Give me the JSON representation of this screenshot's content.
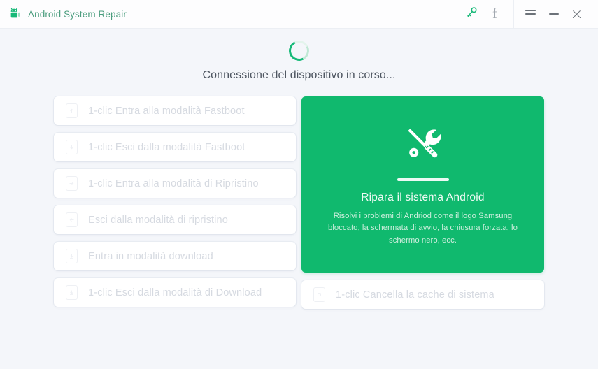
{
  "window": {
    "title": "Android System Repair",
    "logo_icon": "android-robot-icon",
    "controls": [
      {
        "name": "register-key-button",
        "icon": "key-icon",
        "label": "",
        "color": "#17b978"
      },
      {
        "name": "facebook-button",
        "icon": "facebook-f-icon",
        "label": "f",
        "color": "#a2a8b0"
      },
      {
        "name": "menu-button",
        "icon": "hamburger-menu-icon",
        "label": "",
        "color": "#6c7279"
      },
      {
        "name": "minimize-button",
        "icon": "minimize-icon",
        "label": "",
        "color": "#6c7279"
      },
      {
        "name": "close-button",
        "icon": "close-icon",
        "label": "",
        "color": "#6c7279"
      }
    ]
  },
  "status": {
    "spinner_icon": "loading-spinner-icon",
    "text": "Connessione del dispositivo in corso..."
  },
  "options": [
    {
      "icon": "phone-arrow-up-icon",
      "label": "1-clic Entra alla modalità Fastboot"
    },
    {
      "icon": "phone-arrow-down-icon",
      "label": "1-clic Esci dalla modalità Fastboot"
    },
    {
      "icon": "phone-arrow-right-icon",
      "label": "1-clic Entra alla modalità di Ripristino"
    },
    {
      "icon": "phone-arrow-left-icon",
      "label": "Esci dalla modalità di ripristino"
    },
    {
      "icon": "phone-download-icon",
      "label": "Entra in modalità download"
    },
    {
      "icon": "phone-download-exit-icon",
      "label": "1-clic Esci dalla modalità di Download"
    }
  ],
  "cache_option": {
    "icon": "phone-cache-icon",
    "label": "1-clic Cancella la cache di sistema"
  },
  "repair_card": {
    "icon": "wrench-screwdriver-icon",
    "title": "Ripara il sistema Android",
    "description": "Risolvi i problemi di Andriod come il logo Samsung bloccato, la schermata di avvio, la chiusura forzata, lo schermo nero, ecc.",
    "accent_color": "#10b96e"
  },
  "theme": {
    "background": "#f4f6fa",
    "titlebar_background": "#fdfdfe",
    "accent_green": "#10b96e",
    "disabled_text": "#d6dae1"
  }
}
